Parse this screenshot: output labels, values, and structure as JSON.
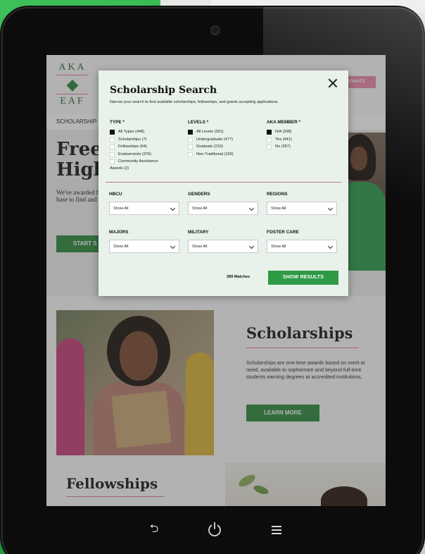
{
  "site": {
    "logo_top": "AKA",
    "logo_bottom": "EAF",
    "donate_label": "DONATE",
    "nav_item": "SCHOLARSHIP",
    "hero_title": "Free\nHigh",
    "hero_body": "We've awarded higher educati and need-base to find and app",
    "hero_button": "START S",
    "scholarships_title": "Scholarships",
    "scholarships_body": "Scholarships are one-time awards based on merit or need, available to sophomore and beyond full-time students earning degrees at accredited institutions.",
    "learn_more_label": "LEARN MORE",
    "fellowships_title": "Fellowships"
  },
  "modal": {
    "title": "Scholarship Search",
    "subtitle": "Narrow your search to find available scholarships, fellowships, and grants accepting applications.",
    "type": {
      "heading": "TYPE *",
      "options": [
        {
          "label": "All Types (448)",
          "checked": true
        },
        {
          "label": "Scholarships (7)",
          "checked": false
        },
        {
          "label": "Fellowships (64)",
          "checked": false
        },
        {
          "label": "Endowments (376)",
          "checked": false
        },
        {
          "label": "Community Assistance",
          "checked": false
        }
      ],
      "continuation": "Awards (2)"
    },
    "levels": {
      "heading": "LEVELS *",
      "options": [
        {
          "label": "All Levels (391)",
          "checked": true
        },
        {
          "label": "Undergraduate (477)",
          "checked": false
        },
        {
          "label": "Graduate (210)",
          "checked": false
        },
        {
          "label": "Non-Traditional (193)",
          "checked": false
        }
      ]
    },
    "aka_member": {
      "heading": "AKA MEMBER *",
      "options": [
        {
          "label": "N/A (398)",
          "checked": true
        },
        {
          "label": "Yes (441)",
          "checked": false
        },
        {
          "label": "No (357)",
          "checked": false
        }
      ]
    },
    "dropdowns": {
      "hbcu": {
        "label": "HBCU",
        "value": "Show All"
      },
      "genders": {
        "label": "GENDERS",
        "value": "Show All"
      },
      "regions": {
        "label": "REGIONS",
        "value": "Show All"
      },
      "majors": {
        "label": "MAJORS",
        "value": "Show All"
      },
      "military": {
        "label": "MILITARY",
        "value": "Show All"
      },
      "foster_care": {
        "label": "FOSTER CARE",
        "value": "Show All"
      }
    },
    "matches": "389 Matches",
    "show_results_label": "SHOW RESULTS"
  },
  "device": {
    "back_glyph": "⮌"
  },
  "colors": {
    "accent_green": "#2f9a44",
    "accent_pink": "#e98aa6",
    "modal_bg": "#e8f1ea"
  }
}
